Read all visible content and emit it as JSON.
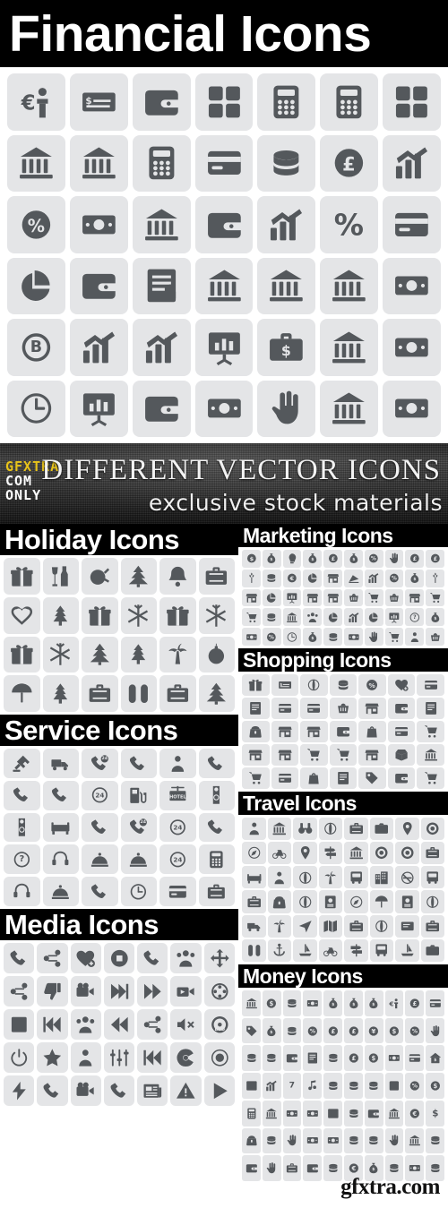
{
  "header": {
    "title": "Financial Icons"
  },
  "banner": {
    "logo_line1": "GFXTRA",
    "logo_line2": "COM",
    "logo_line3": "ONLY",
    "title": "DIFFERENT VECTOR ICONS",
    "subtitle": "exclusive stock materials"
  },
  "watermark": {
    "text": "gfxtra.com"
  },
  "colors": {
    "tile_bg": "#e4e5e7",
    "icon_fill": "#54585c",
    "titlebar_bg": "#000000",
    "titlebar_text": "#ffffff",
    "logo_accent": "#e8c31a",
    "page_bg": "#ffffff"
  },
  "sections": [
    {
      "id": "financial",
      "title": "Financial Icons",
      "columns": 7,
      "rows": 6,
      "count": 42,
      "icons": [
        "euro-businessman",
        "cheque-pen",
        "wallet",
        "calculator-keys",
        "calculator",
        "calculator-display",
        "calculator-operations",
        "piggy-bank",
        "bank-building",
        "calculator-keypad",
        "card-dollar",
        "coins-pound",
        "pound-coin",
        "chart-up-arrow",
        "percent-coin",
        "dollar-bill",
        "bank-classic",
        "wallet-card",
        "bar-chart",
        "percent-sign",
        "credit-card",
        "pie-chart-donut",
        "wallet-refresh",
        "document-lock",
        "dollar-banknote",
        "bank-columns",
        "bank-pillars",
        "cash-register",
        "bitcoin-coin",
        "growth-chart",
        "bar-growth-arrow",
        "presentation-chart",
        "briefcase-dollar",
        "bank-temple",
        "dollar-note",
        "time-money",
        "presentation-bars",
        "wallet-cash",
        "dollar-bills-stack",
        "hands-dollar",
        "piggy-bank-coin",
        "pound-note"
      ]
    },
    {
      "id": "holiday",
      "title": "Holiday Icons",
      "columns": 6,
      "rows": 4,
      "count": 24,
      "icons": [
        "gift-box",
        "wine-bottle-glass",
        "roast-turkey",
        "christmas-tree",
        "jingle-bells",
        "suitcase-travel",
        "heart-outline",
        "pine-trees",
        "gift-ribbon",
        "snowflake",
        "gift-ornament",
        "snowflake-star",
        "gift-present",
        "snowflake-detailed",
        "fir-tree",
        "pine-tree-outline",
        "palm-beach",
        "ornament-ball",
        "beach-umbrella",
        "tree-outline",
        "luggage-trolley",
        "flip-flops",
        "suitcase",
        "decorated-tree"
      ]
    },
    {
      "id": "marketing",
      "title": "Marketing Icons",
      "columns": 10,
      "rows": 5,
      "count": 50,
      "icons": [
        "dollar-coin",
        "money-bag",
        "head-idea",
        "money-bag-dollar",
        "pound-shield",
        "money-bag-euro",
        "percent-circle",
        "hand-plant",
        "pound-exchange",
        "pound-circle",
        "wheat-tag",
        "coin-pound",
        "euro-circle",
        "pie-chart",
        "store-front",
        "cake-slice",
        "bar-chart-arrow",
        "percent",
        "money-bag-small",
        "wheat-ears",
        "shopping-cart",
        "pie-chart-segment",
        "report-chart",
        "cart-shop",
        "shop-awning",
        "basket",
        "cart-full",
        "basket-checkout",
        "market-stall",
        "cart-empty",
        "cart-add",
        "hand-coins",
        "store-building",
        "people-growth",
        "pie-chart-slice",
        "chart-growth",
        "pie-circle",
        "presentation-board",
        "question-circle",
        "money-sack",
        "cash-stack",
        "percent-tag",
        "clock-chart",
        "coin-bag",
        "megaphone-coin",
        "hand-cash",
        "hand-target",
        "cart-side",
        "graduate-cap",
        "basket-goods"
      ]
    },
    {
      "id": "shopping",
      "title": "Shopping Icons",
      "columns": 7,
      "rows": 5,
      "count": 35,
      "icons": [
        "gift",
        "cheque-signature",
        "hands-globe",
        "hand-coin",
        "hand-percent",
        "heart-add",
        "card-swipe",
        "invoice-dollar",
        "card-hand",
        "credit-card",
        "basket-check",
        "shop-awning",
        "wallet-card",
        "document-lock",
        "coin-purse",
        "shopping-bag-hand",
        "store-front",
        "wallet-cards",
        "bag-lock",
        "cards-stack",
        "cart-grid",
        "basket-shop",
        "store-small",
        "cart-side",
        "cart-goods",
        "shop-market",
        "box-open",
        "building-store",
        "cart-wheel",
        "card-payment",
        "bag-gift",
        "receipt",
        "tag-price",
        "wallet-open",
        "cart-checkout"
      ]
    },
    {
      "id": "service",
      "title": "Service Icons",
      "columns": 6,
      "rows": 5,
      "count": 30,
      "icons": [
        "hammer-pick",
        "delivery-truck",
        "phone-24",
        "phone-transfer",
        "concierge-person",
        "phone-ringing",
        "phone-handset",
        "phone-signal",
        "clock-24",
        "fuel-pump",
        "hotel-sign",
        "door-hanger-no",
        "door-hanger-check",
        "bed-hotel",
        "phone-forward",
        "phone-24-alert",
        "24-7-tag",
        "office-phone",
        "question-mark",
        "headset-support",
        "room-service",
        "restaurant-cloche",
        "24h-badge",
        "calculator-phone",
        "support-agent",
        "bell-service",
        "phone-book",
        "clock-service",
        "key-card",
        "suitcase-service"
      ]
    },
    {
      "id": "travel",
      "title": "Travel Icons",
      "columns": 8,
      "rows": 6,
      "count": 48,
      "icons": [
        "person-location",
        "building-hotel",
        "binoculars",
        "globe",
        "backpack",
        "camera-bag",
        "map-pin",
        "lifeguard",
        "compass-star",
        "bicycle",
        "location-pin",
        "signpost",
        "hotel-building",
        "life-ring",
        "ring-buoy",
        "luggage",
        "bed",
        "traveler-person",
        "globe-grid",
        "palm-island",
        "train-cabin",
        "city-buildings",
        "no-smoking",
        "bus",
        "briefcase-travel",
        "coin-purse",
        "globe-web",
        "passport-stack",
        "compass-rose",
        "beach-umbrella",
        "passport-id",
        "globe-sphere",
        "van-bus",
        "palm-tree",
        "paper-plane",
        "folded-map",
        "travel-bag",
        "globe-stand",
        "ticket-book",
        "suitcase-wheel",
        "flip-flops",
        "anchor",
        "sailboat",
        "bicycle-ride",
        "signpost-direction",
        "train",
        "speedboat",
        "camera-photo"
      ]
    },
    {
      "id": "media",
      "title": "Media Icons",
      "columns": 7,
      "rows": 5,
      "count": 35,
      "icons": [
        "microphone-curve",
        "share-network",
        "heart-add",
        "stop-button",
        "microphone",
        "people-group",
        "move-arrows",
        "share-nodes",
        "thumbs-down",
        "film-projector",
        "skip-forward",
        "fast-forward",
        "video-camera-play",
        "film-reel",
        "stop-square",
        "skip-back",
        "people-presentation",
        "rewind",
        "box-share",
        "volume-mute",
        "dvd-disc",
        "power-button",
        "star-badge",
        "user-circle",
        "equalizer-sliders",
        "skip-previous",
        "radiation-symbol",
        "record-circle",
        "lightning-bolt",
        "microphone-stand",
        "video-camera",
        "microphone-small",
        "newspaper",
        "warning-sign",
        "play-button"
      ]
    },
    {
      "id": "money",
      "title": "Money Icons",
      "columns": 10,
      "rows": 7,
      "count": 70,
      "icons": [
        "banknote",
        "dollar-coin",
        "coin-stack",
        "dollar-bill",
        "pound-bag",
        "money-bag",
        "coin-bag",
        "euro-businessman",
        "pound-shield",
        "card-swipe",
        "price-tag",
        "money-bag-small",
        "coins-pile",
        "percent-coin",
        "pound-exchange",
        "pound-circle",
        "yen-circle",
        "dollar-circle",
        "hand-percent",
        "hand-money",
        "coin-drop",
        "hand-coin",
        "wallet-cards",
        "invoice-dollar",
        "coin-stack-small",
        "pound-coin",
        "dollar-sphere",
        "dollar-note",
        "card-hand",
        "house-money",
        "safe-box",
        "bar-chart-money",
        "seven-lucky",
        "music-note",
        "coin-small",
        "coin-medium",
        "coin-large",
        "dollar-pile",
        "percent-badge",
        "dollar-badge",
        "calculator",
        "piggy-bank",
        "cash-register",
        "money-roll",
        "gold-bar",
        "coin-toss",
        "wallet-money",
        "bank-note",
        "euro-sign",
        "dollar-sign",
        "coin-purse",
        "magnifier-coin",
        "hand-dollar",
        "money-roll-two",
        "dollar-note-curl",
        "coins-stack-two",
        "coins-many",
        "hand-give",
        "bank-safe",
        "coin-row",
        "wallet-purse",
        "hand-plant",
        "briefcase-money",
        "wallet-hand",
        "hand-coins-give",
        "euro-coins",
        "money-bag-dollar",
        "coins-layered",
        "cash-bundle",
        "coin-pile"
      ]
    }
  ]
}
